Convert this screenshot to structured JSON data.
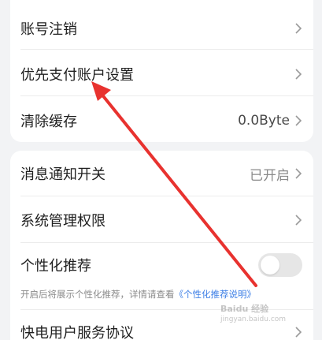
{
  "settings_top": {
    "items": [
      {
        "label": "账号注销"
      },
      {
        "label": "优先支付账户设置"
      },
      {
        "label": "清除缓存",
        "value": "0.0Byte"
      }
    ]
  },
  "settings_bottom": {
    "notification": {
      "label": "消息通知开关",
      "value": "已开启"
    },
    "permissions": {
      "label": "系统管理权限"
    },
    "personalized": {
      "label": "个性化推荐",
      "enabled": false,
      "hint": "开启后将展示个性化推荐，详情请查看",
      "hint_link": "《个性化推荐说明》"
    },
    "agreement": {
      "label": "快电用户服务协议"
    }
  },
  "annotation": {
    "arrow_color": "#e8322f"
  },
  "watermark": {
    "text": "Baidu 经验",
    "sub": "jingyan.baidu.com"
  }
}
